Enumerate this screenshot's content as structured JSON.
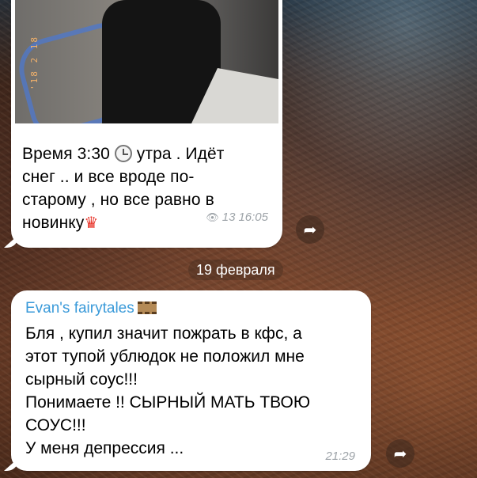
{
  "post": {
    "photo_datestamp": "'18 2 18",
    "caption_line1_a": "Время 3:30",
    "caption_line1_b": "утра . Идёт",
    "caption_line2": "снег .. и все вроде по-",
    "caption_line3": "старому , но все равно в",
    "caption_line4": "новинку",
    "clock_emoji": "clock-icon",
    "crown_emoji": "♛",
    "views": "13",
    "time": "16:05",
    "eye_glyph": "👁"
  },
  "date_separator": "19 февраля",
  "message": {
    "author": "Evan's fairytales",
    "lines": [
      "Бля , купил значит пожрать в кфс, а",
      "этот тупой ублюдок не положил мне",
      "сырный соус!!!",
      "Понимаете !! СЫРНЫЙ МАТЬ ТВОЮ",
      "СОУС!!!",
      "У меня депрессия ..."
    ],
    "time": "21:29"
  },
  "icons": {
    "share": "➦"
  },
  "colors": {
    "author": "#3a9ad9",
    "meta": "#9da3a8",
    "bubble": "#ffffff"
  }
}
